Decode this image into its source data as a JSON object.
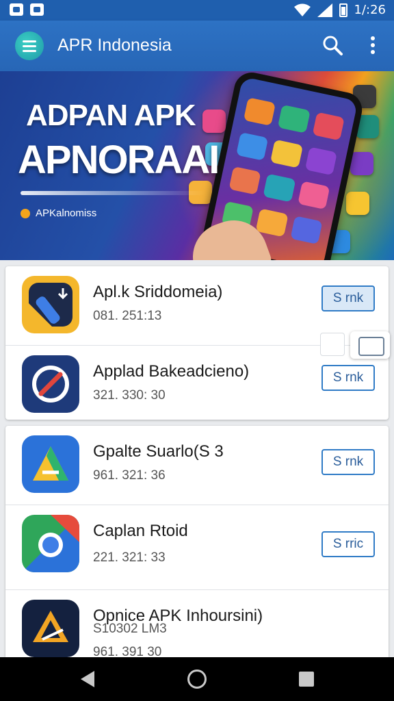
{
  "status_bar": {
    "time": "1/:26"
  },
  "app_bar": {
    "title": "APR Indonesia"
  },
  "banner": {
    "title_line1": "ADPAN APK",
    "title_line2": "APNORAAI",
    "tagline": "APKalnomiss"
  },
  "apps": [
    {
      "name": "Apl.k Sriddomeia)",
      "subtitle": "081. 251:13",
      "button_label": "S rnk",
      "icon": "download-tool-icon"
    },
    {
      "name": "Applad Bakeadcieno)",
      "subtitle": "321. 330: 30",
      "button_label": "S rnk",
      "icon": "compass-icon"
    },
    {
      "name": "Gpalte Suarlo(S  3",
      "subtitle": "961. 321: 36",
      "button_label": "S rnk",
      "icon": "drive-triangle-icon"
    },
    {
      "name": "Caplan Rtoid",
      "subtitle": "221. 321: 33",
      "button_label": "S rric",
      "icon": "chrome-icon"
    },
    {
      "name": "Opnice  APK Inhoursini)",
      "subtitle": "S10302 LM3",
      "subtitle2": "961. 391 30",
      "icon": "delta-triangle-icon"
    }
  ],
  "colors": {
    "app_bar": "#2766b6",
    "accent": "#2f7bc6",
    "status_bar": "#1f5fae"
  }
}
